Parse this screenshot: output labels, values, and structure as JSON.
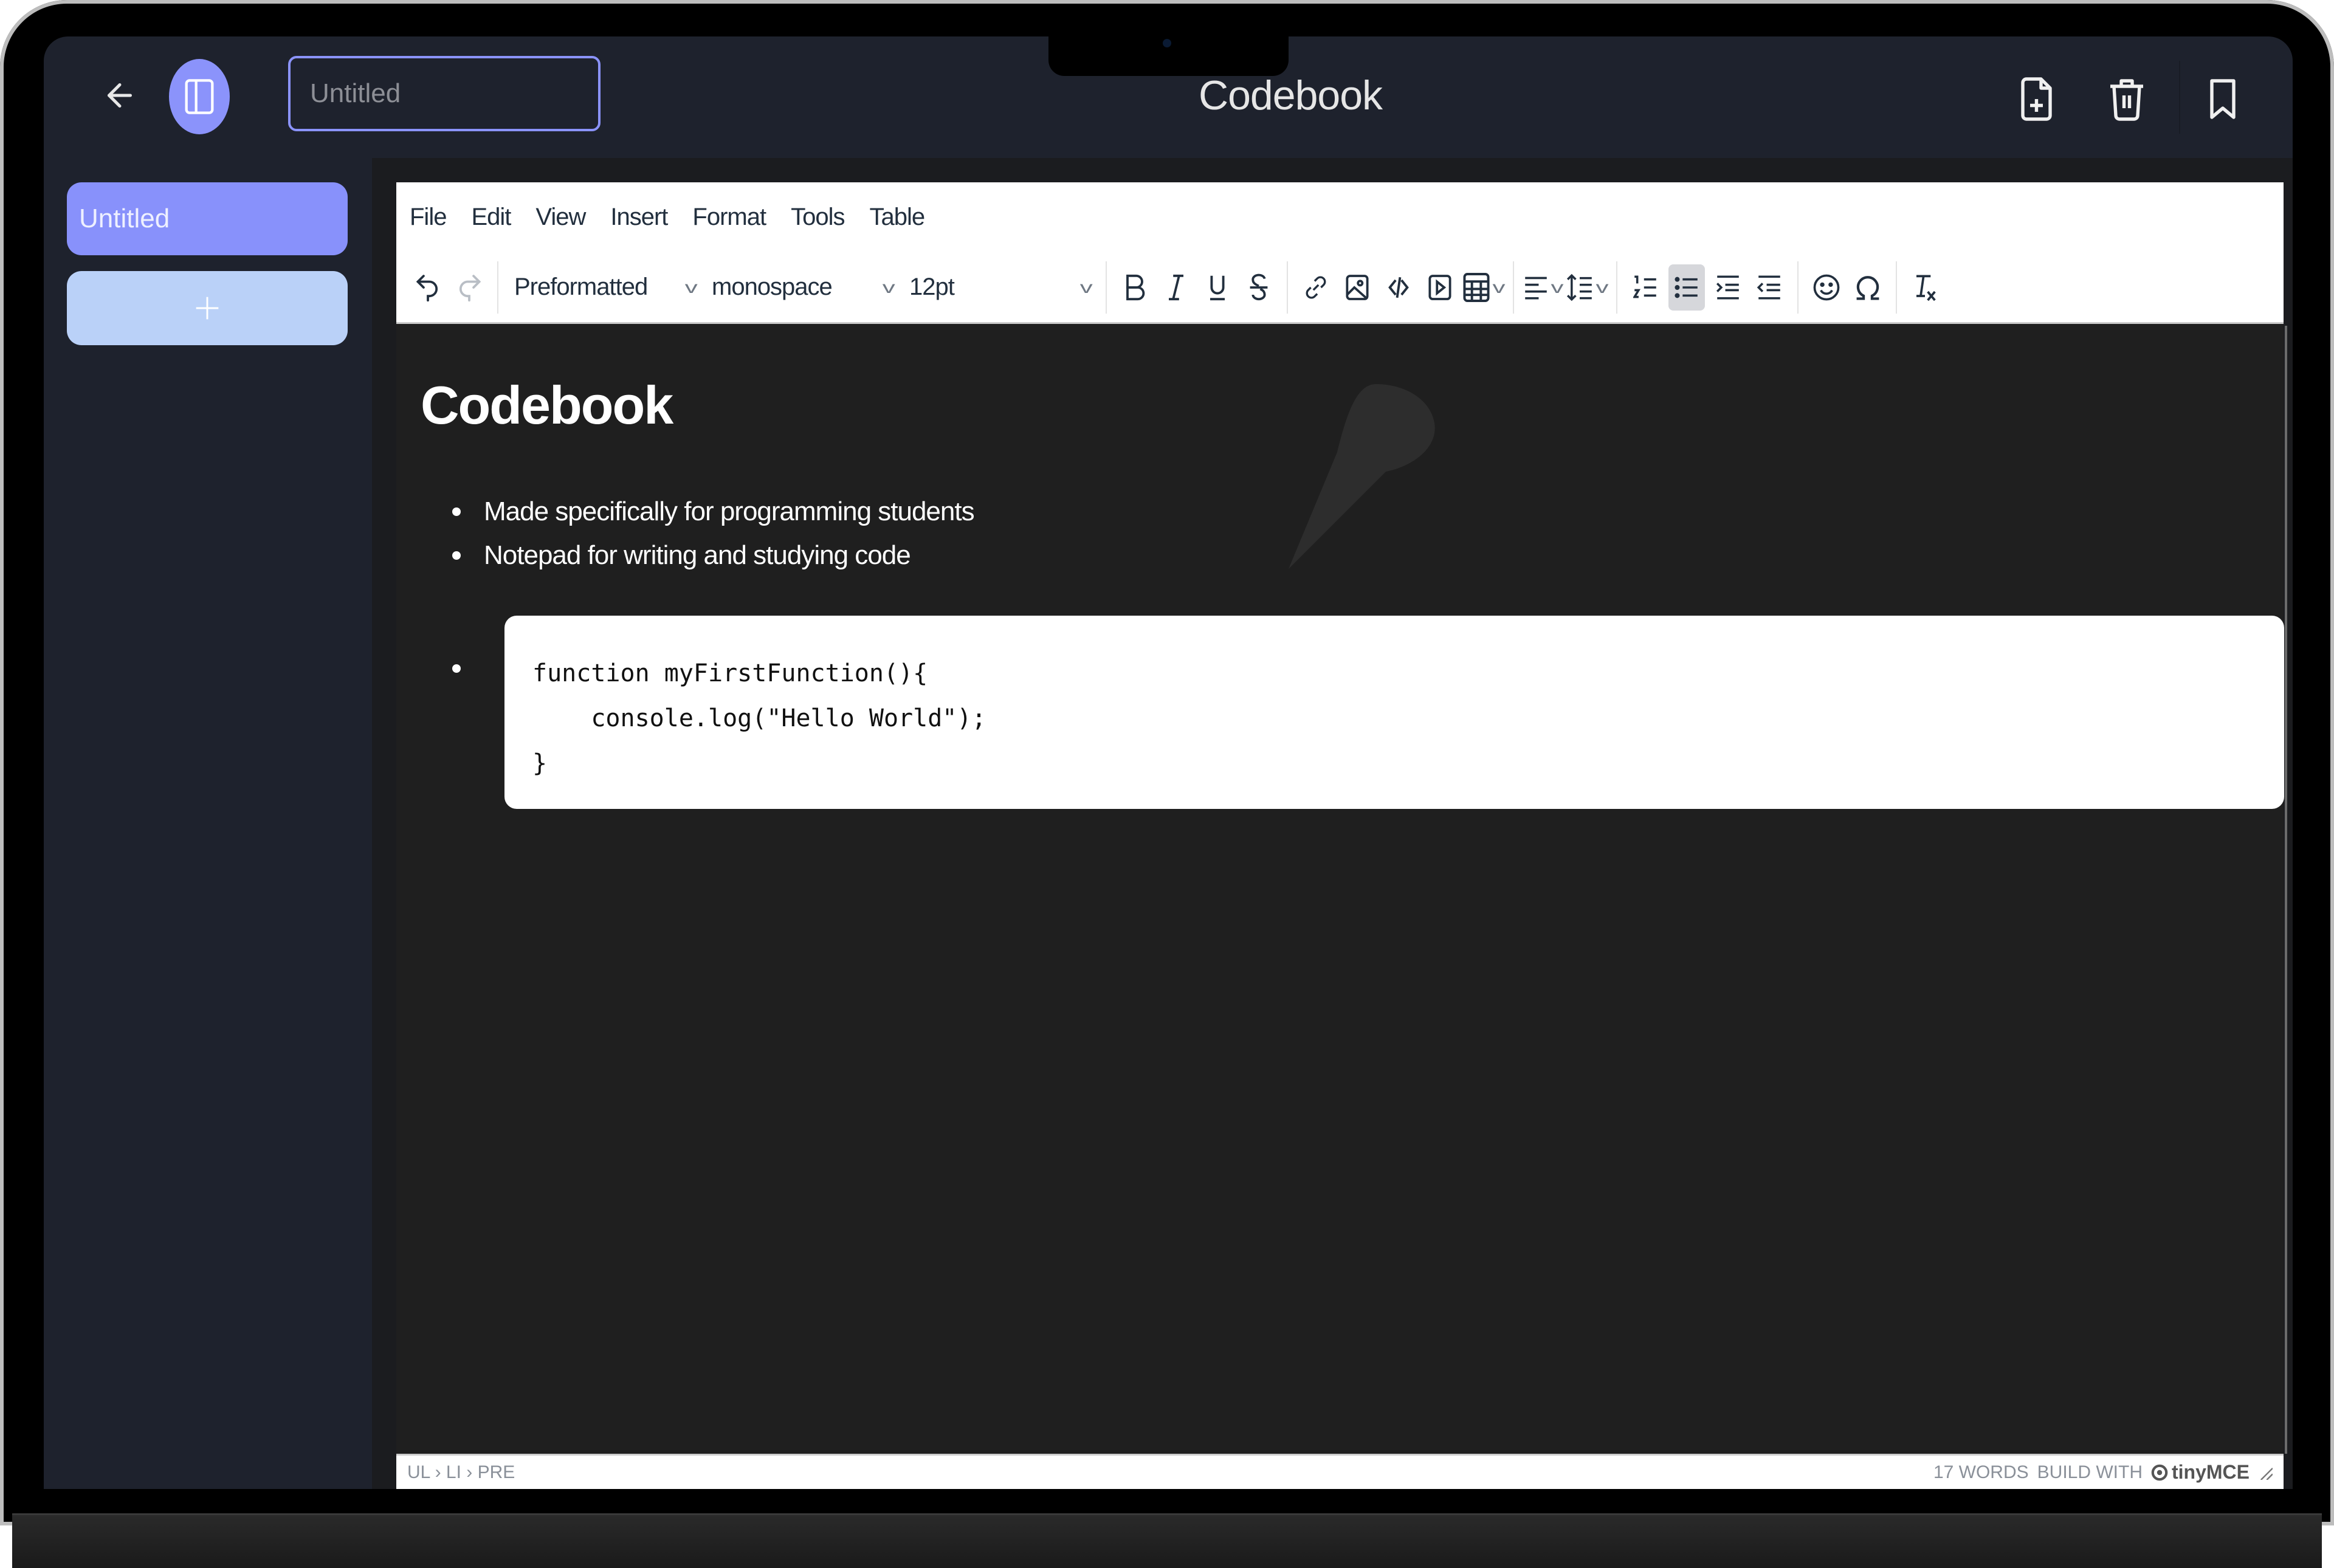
{
  "header": {
    "title_input_placeholder": "Untitled",
    "app_title": "Codebook",
    "icons": {
      "back": "arrow-left-icon",
      "sidebar_toggle": "sidebar-panel-icon",
      "new_file": "file-plus-icon",
      "delete": "trash-icon",
      "bookmark": "bookmark-icon"
    }
  },
  "sidebar": {
    "notes": [
      {
        "label": "Untitled",
        "active": true
      }
    ],
    "add_button_label": "+"
  },
  "editor": {
    "menu": [
      "File",
      "Edit",
      "View",
      "Insert",
      "Format",
      "Tools",
      "Table"
    ],
    "toolbar": {
      "block_format": "Preformatted",
      "font_family": "monospace",
      "font_size": "12pt",
      "buttons": [
        "undo",
        "redo",
        "bold",
        "italic",
        "underline",
        "strikethrough",
        "link",
        "image",
        "code",
        "media",
        "table",
        "align",
        "line-height",
        "numbered-list",
        "bullet-list",
        "indent",
        "outdent",
        "emoticons",
        "special-character",
        "clear-formatting"
      ],
      "active_button": "bullet-list"
    },
    "content": {
      "heading": "Codebook",
      "bullets": [
        "Made specifically for programming students",
        "Notepad for writing and studying code"
      ],
      "code_lines": [
        "function myFirstFunction(){",
        "    console.log(\"Hello World\");",
        "}"
      ]
    },
    "statusbar": {
      "path": "UL › LI › PRE",
      "word_count": "17 WORDS",
      "build_with": "BUILD WITH",
      "brand": "tinyMCE"
    }
  },
  "colors": {
    "accent": "#8b93fb",
    "add_button": "#bad1f8",
    "app_bg": "#1e222d",
    "editor_bg": "#1f1f1f"
  }
}
